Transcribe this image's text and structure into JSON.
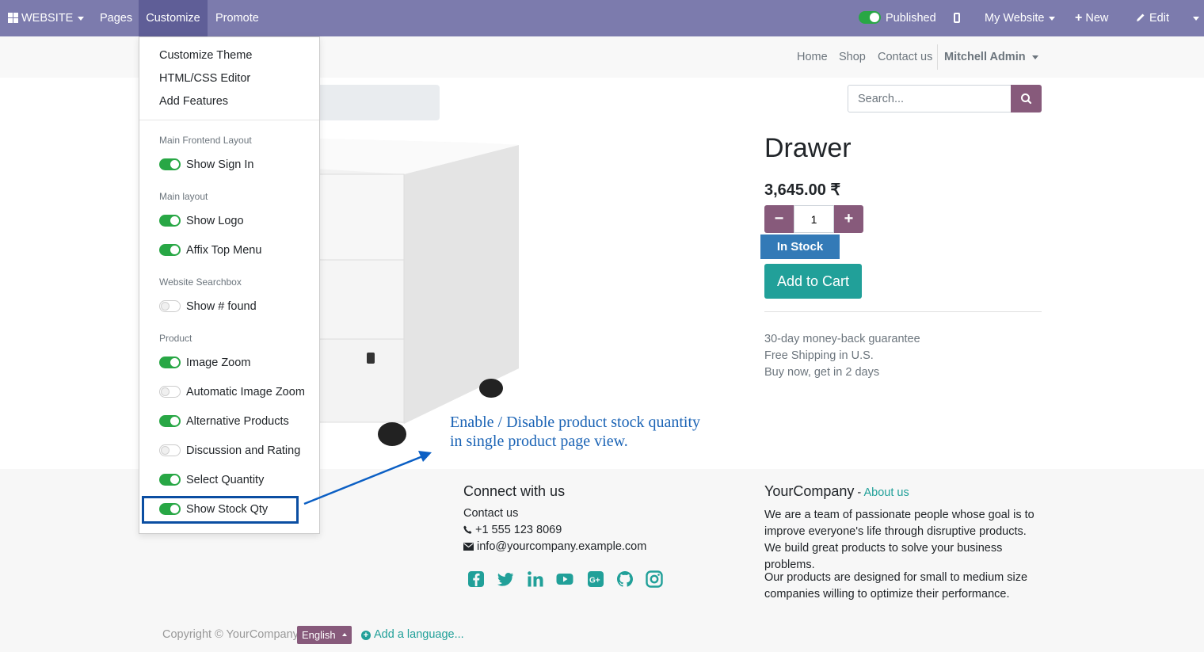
{
  "topbar": {
    "website_label": "WEBSITE",
    "pages_label": "Pages",
    "customize_label": "Customize",
    "promote_label": "Promote",
    "published_label": "Published",
    "my_website_label": "My Website",
    "new_label": "New",
    "edit_label": "Edit"
  },
  "navbar": {
    "links": [
      "Home",
      "Shop",
      "Contact us"
    ],
    "user": "Mitchell Admin"
  },
  "search": {
    "placeholder": "Search..."
  },
  "product": {
    "title": "Drawer",
    "price": "3,645.00 ₹",
    "quantity": "1",
    "stock_label": "In Stock",
    "add_to_cart": "Add to Cart",
    "guarantees": [
      "30-day money-back guarantee",
      "Free Shipping in U.S.",
      "Buy now, get in 2 days"
    ]
  },
  "customize_menu": {
    "items": [
      "Customize Theme",
      "HTML/CSS Editor",
      "Add Features"
    ],
    "sections": [
      {
        "header": "Main Frontend Layout",
        "options": [
          {
            "label": "Show Sign In",
            "on": true
          }
        ]
      },
      {
        "header": "Main layout",
        "options": [
          {
            "label": "Show Logo",
            "on": true
          },
          {
            "label": "Affix Top Menu",
            "on": true
          }
        ]
      },
      {
        "header": "Website Searchbox",
        "options": [
          {
            "label": "Show # found",
            "on": false
          }
        ]
      },
      {
        "header": "Product",
        "options": [
          {
            "label": "Image Zoom",
            "on": true
          },
          {
            "label": "Automatic Image Zoom",
            "on": false
          },
          {
            "label": "Alternative Products",
            "on": true
          },
          {
            "label": "Discussion and Rating",
            "on": false
          },
          {
            "label": "Select Quantity",
            "on": true
          },
          {
            "label": "Show Stock Qty",
            "on": true
          }
        ]
      }
    ]
  },
  "annotation": {
    "line1": "Enable / Disable product stock quantity",
    "line2": "in single product page view."
  },
  "footer": {
    "connect_title": "Connect with us",
    "contact_link": "Contact us",
    "phone": "+1 555 123 8069",
    "email": "info@yourcompany.example.com",
    "company_name": "YourCompany",
    "about_link": "About us",
    "about_text_1": "We are a team of passionate people whose goal is to improve everyone's life through disruptive products. We build great products to solve your business problems.",
    "about_text_2": "Our products are designed for small to medium size companies willing to optimize their performance.",
    "copyright": "Copyright © YourCompany",
    "language": "English",
    "add_language": "Add a language...",
    "social_icons": [
      "facebook-icon",
      "twitter-icon",
      "linkedin-icon",
      "youtube-icon",
      "google-plus-icon",
      "github-icon",
      "instagram-icon"
    ]
  },
  "colors": {
    "admin_bar": "#7c7bad",
    "brand_primary": "#875a7b",
    "teal": "#21a099",
    "stock_badge": "#337ab7",
    "toggle_on": "#28a745",
    "annotation": "#1a63b5"
  }
}
